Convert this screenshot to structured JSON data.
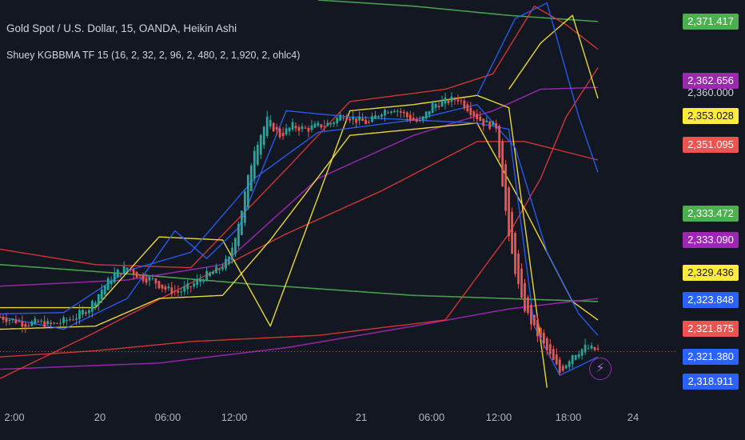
{
  "header": {
    "title": "Gold Spot / U.S. Dollar, 15, OANDA, Heikin Ashi",
    "indicator": "Shuey KGBBMA TF 15 (16, 2, 32, 2, 96, 2, 480, 2, 1,920, 2, ohlc4)"
  },
  "colors": {
    "background": "#131722",
    "up": "#26a69a",
    "down": "#ef5350",
    "green_line": "#4caf50",
    "purple_line": "#9c27b0",
    "yellow_line": "#ffeb3b",
    "red_line": "#e53935",
    "blue_line": "#2962ff"
  },
  "icons": {
    "alert": "lightning-bolt-icon"
  },
  "chart_data": {
    "type": "candlestick",
    "y_axis": {
      "ylim": [
        2314,
        2379
      ],
      "position": "right"
    },
    "x_axis": {
      "tick_labels": [
        "2:00",
        "20",
        "06:00",
        "12:00",
        "21",
        "06:00",
        "12:00",
        "18:00",
        "24"
      ]
    },
    "axis_ticks_visible": [
      "2,360.000"
    ],
    "price_tags": [
      {
        "label": "2,371.417",
        "value": 2371.417,
        "bg": "#4caf50",
        "fg": "#ffffff"
      },
      {
        "label": "2,362.656",
        "value": 2362.656,
        "bg": "#9c27b0",
        "fg": "#ffffff"
      },
      {
        "label": "2,353.028",
        "value": 2353.028,
        "bg": "#ffeb3b",
        "fg": "#131722"
      },
      {
        "label": "2,351.095",
        "value": 2351.095,
        "bg": "#ef5350",
        "fg": "#ffffff"
      },
      {
        "label": "2,333.472",
        "value": 2333.472,
        "bg": "#4caf50",
        "fg": "#ffffff"
      },
      {
        "label": "2,333.090",
        "value": 2333.09,
        "bg": "#9c27b0",
        "fg": "#ffffff"
      },
      {
        "label": "2,329.436",
        "value": 2329.436,
        "bg": "#ffeb3b",
        "fg": "#131722"
      },
      {
        "label": "2,323.848",
        "value": 2323.848,
        "bg": "#2962ff",
        "fg": "#ffffff"
      },
      {
        "label": "2,321.875",
        "value": 2321.875,
        "bg": "#ef5350",
        "fg": "#ffffff"
      },
      {
        "label": "2,321.380",
        "value": 2321.38,
        "bg": "#2962ff",
        "fg": "#ffffff"
      },
      {
        "label": "2,318.911",
        "value": 2318.911,
        "bg": "#2962ff",
        "fg": "#ffffff"
      }
    ],
    "last_price": 2321.875,
    "close_path": [
      [
        0,
        2327.5
      ],
      [
        4,
        2327.0
      ],
      [
        8,
        2326.4
      ],
      [
        12,
        2326.6
      ],
      [
        16,
        2326.2
      ],
      [
        20,
        2326.8
      ],
      [
        24,
        2327.6
      ],
      [
        28,
        2329.0
      ],
      [
        32,
        2332.0
      ],
      [
        36,
        2334.5
      ],
      [
        40,
        2335.5
      ],
      [
        44,
        2334.0
      ],
      [
        48,
        2333.5
      ],
      [
        52,
        2332.0
      ],
      [
        56,
        2331.5
      ],
      [
        60,
        2332.5
      ],
      [
        64,
        2334.0
      ],
      [
        68,
        2335.0
      ],
      [
        72,
        2336.8
      ],
      [
        76,
        2345.0
      ],
      [
        80,
        2355.0
      ],
      [
        84,
        2359.5
      ],
      [
        88,
        2357.0
      ],
      [
        92,
        2358.5
      ],
      [
        96,
        2358.0
      ],
      [
        100,
        2358.5
      ],
      [
        104,
        2359.0
      ],
      [
        108,
        2360.5
      ],
      [
        112,
        2359.5
      ],
      [
        116,
        2359.0
      ],
      [
        120,
        2361.0
      ],
      [
        124,
        2361.5
      ],
      [
        128,
        2360.0
      ],
      [
        132,
        2359.0
      ],
      [
        136,
        2362.0
      ],
      [
        140,
        2362.5
      ],
      [
        144,
        2363.0
      ],
      [
        148,
        2361.0
      ],
      [
        152,
        2359.0
      ],
      [
        156,
        2358.5
      ],
      [
        160,
        2340.0
      ],
      [
        164,
        2330.0
      ],
      [
        168,
        2325.5
      ],
      [
        172,
        2322.0
      ],
      [
        176,
        2318.5
      ],
      [
        180,
        2321.5
      ],
      [
        184,
        2322.5
      ],
      [
        188,
        2322.0
      ]
    ],
    "overlay_lines": [
      {
        "name_color": "green_line",
        "width": 1.6,
        "points": [
          [
            0,
            2336.0
          ],
          [
            40,
            2334.5
          ],
          [
            80,
            2332.8
          ],
          [
            130,
            2331.0
          ],
          [
            188,
            2330.0
          ]
        ]
      },
      {
        "name_color": "green_line",
        "width": 1.6,
        "points": [
          [
            100,
            2379.0
          ],
          [
            130,
            2378.0
          ],
          [
            160,
            2376.5
          ],
          [
            188,
            2375.5
          ]
        ]
      },
      {
        "name_color": "purple_line",
        "width": 1.6,
        "points": [
          [
            0,
            2319.0
          ],
          [
            50,
            2320.0
          ],
          [
            90,
            2322.5
          ],
          [
            130,
            2326.0
          ],
          [
            160,
            2328.8
          ],
          [
            188,
            2330.5
          ]
        ]
      },
      {
        "name_color": "purple_line",
        "width": 1.6,
        "points": [
          [
            0,
            2332.5
          ],
          [
            40,
            2333.5
          ],
          [
            70,
            2336.0
          ],
          [
            100,
            2350.0
          ],
          [
            130,
            2357.0
          ],
          [
            155,
            2361.0
          ],
          [
            170,
            2364.5
          ],
          [
            188,
            2364.8
          ]
        ]
      },
      {
        "name_color": "red_line",
        "width": 1.4,
        "points": [
          [
            0,
            2317.5
          ],
          [
            30,
            2325.0
          ],
          [
            60,
            2333.0
          ],
          [
            90,
            2341.0
          ],
          [
            120,
            2348.0
          ],
          [
            150,
            2356.0
          ],
          [
            165,
            2356.0
          ],
          [
            188,
            2353.0
          ]
        ]
      },
      {
        "name_color": "red_line",
        "width": 1.4,
        "points": [
          [
            0,
            2321.0
          ],
          [
            30,
            2322.0
          ],
          [
            60,
            2323.5
          ],
          [
            100,
            2324.5
          ],
          [
            140,
            2327.0
          ],
          [
            160,
            2341.0
          ],
          [
            170,
            2350.0
          ],
          [
            178,
            2360.0
          ],
          [
            188,
            2368.0
          ]
        ]
      },
      {
        "name_color": "red_line",
        "width": 1.4,
        "points": [
          [
            0,
            2338.5
          ],
          [
            30,
            2336.0
          ],
          [
            60,
            2335.5
          ],
          [
            90,
            2351.5
          ],
          [
            110,
            2362.5
          ],
          [
            140,
            2364.5
          ],
          [
            155,
            2367.0
          ],
          [
            168,
            2378.0
          ],
          [
            178,
            2375.0
          ],
          [
            188,
            2371.0
          ]
        ]
      },
      {
        "name_color": "yellow_line",
        "width": 1.4,
        "points": [
          [
            0,
            2329.0
          ],
          [
            30,
            2329.0
          ],
          [
            50,
            2340.5
          ],
          [
            70,
            2340.0
          ],
          [
            85,
            2326.0
          ],
          [
            95,
            2340.0
          ],
          [
            110,
            2361.0
          ],
          [
            130,
            2362.0
          ],
          [
            150,
            2363.5
          ],
          [
            160,
            2361.5
          ],
          [
            172,
            2316.0
          ]
        ]
      },
      {
        "name_color": "yellow_line",
        "width": 1.4,
        "points": [
          [
            0,
            2325.5
          ],
          [
            30,
            2326.0
          ],
          [
            50,
            2330.5
          ],
          [
            70,
            2331.0
          ],
          [
            85,
            2340.0
          ],
          [
            110,
            2357.0
          ],
          [
            130,
            2358.0
          ],
          [
            150,
            2359.0
          ],
          [
            165,
            2345.0
          ],
          [
            180,
            2330.0
          ],
          [
            188,
            2327.0
          ]
        ]
      },
      {
        "name_color": "yellow_line",
        "width": 1.4,
        "points": [
          [
            160,
            2364.5
          ],
          [
            170,
            2372.0
          ],
          [
            180,
            2376.5
          ],
          [
            188,
            2363.0
          ]
        ]
      },
      {
        "name_color": "blue_line",
        "width": 1.4,
        "points": [
          [
            0,
            2327.5
          ],
          [
            20,
            2325.5
          ],
          [
            40,
            2330.5
          ],
          [
            55,
            2341.5
          ],
          [
            65,
            2337.0
          ],
          [
            75,
            2342.0
          ],
          [
            90,
            2361.0
          ],
          [
            110,
            2360.0
          ],
          [
            130,
            2359.5
          ],
          [
            150,
            2359.0
          ],
          [
            160,
            2358.0
          ],
          [
            168,
            2326.0
          ],
          [
            176,
            2318.0
          ],
          [
            188,
            2321.0
          ]
        ]
      },
      {
        "name_color": "blue_line",
        "width": 1.4,
        "points": [
          [
            0,
            2328.0
          ],
          [
            20,
            2328.2
          ],
          [
            40,
            2335.0
          ],
          [
            60,
            2338.0
          ],
          [
            80,
            2350.0
          ],
          [
            100,
            2357.5
          ],
          [
            130,
            2359.5
          ],
          [
            150,
            2362.0
          ],
          [
            162,
            2355.0
          ],
          [
            172,
            2338.0
          ],
          [
            182,
            2328.0
          ],
          [
            188,
            2324.5
          ]
        ]
      },
      {
        "name_color": "blue_line",
        "width": 1.4,
        "points": [
          [
            150,
            2363.5
          ],
          [
            162,
            2376.0
          ],
          [
            172,
            2378.5
          ],
          [
            182,
            2360.0
          ],
          [
            188,
            2351.0
          ]
        ]
      }
    ]
  }
}
